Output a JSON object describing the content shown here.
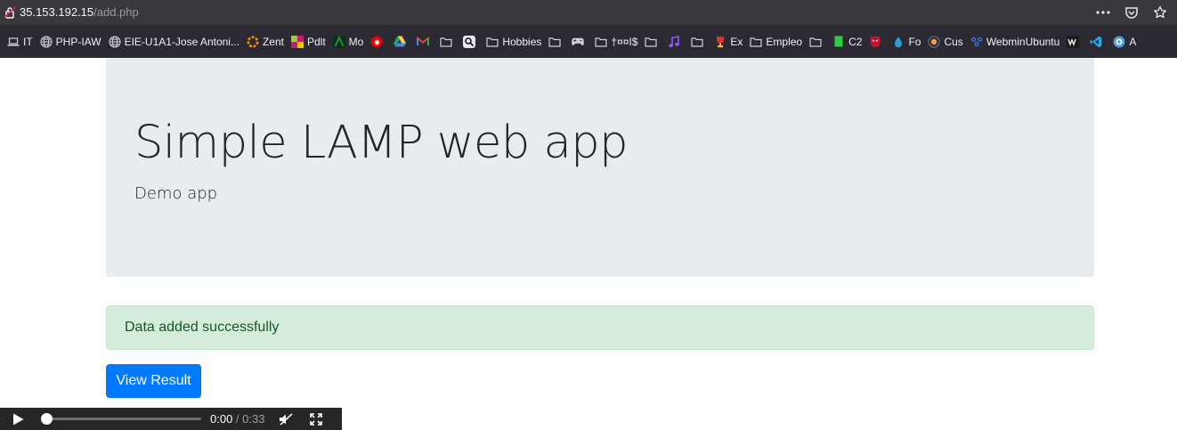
{
  "browser": {
    "url_host": "35.153.192.15",
    "url_path": "/add.php",
    "page_actions_icon": "ellipsis-icon",
    "pocket_icon": "pocket-icon",
    "bookmark_star_icon": "star-icon"
  },
  "bookmarks": [
    {
      "label": "IT",
      "icon": "laptop-icon",
      "color": "#cfcfd3"
    },
    {
      "label": "PHP-IAW",
      "icon": "globe-icon",
      "color": "#cfcfd3"
    },
    {
      "label": "EIE-U1A1-Jose Antoni...",
      "icon": "globe-icon",
      "color": "#cfcfd3"
    },
    {
      "label": "Zent",
      "icon": "zent-icon",
      "color": "#f29111"
    },
    {
      "label": "Pdlt",
      "icon": "pdlt-icon",
      "color": "#c71a75"
    },
    {
      "label": "Mo",
      "icon": "moodle-icon",
      "color": "#1e8f3c"
    },
    {
      "label": "",
      "icon": "vodafone-icon",
      "color": "#e60000"
    },
    {
      "label": "",
      "icon": "google-drive-icon",
      "color": "#1fa463"
    },
    {
      "label": "",
      "icon": "gmail-icon",
      "color": "#ea4335"
    },
    {
      "label": "",
      "icon": "folder-icon",
      "color": "#cfcfd3"
    },
    {
      "label": "",
      "icon": "magnifier-icon",
      "color": "#ffffff"
    },
    {
      "label": "Hobbies",
      "icon": "folder-icon",
      "color": "#cfcfd3"
    },
    {
      "label": "",
      "icon": "folder-icon",
      "color": "#cfcfd3"
    },
    {
      "label": "",
      "icon": "gamepad-icon",
      "color": "#cfcfd3"
    },
    {
      "label": "†¤¤I$",
      "icon": "folder-icon",
      "color": "#cfcfd3"
    },
    {
      "label": "",
      "icon": "folder-icon",
      "color": "#cfcfd3"
    },
    {
      "label": "",
      "icon": "music-note-icon",
      "color": "#8b5cf6"
    },
    {
      "label": "",
      "icon": "folder-icon",
      "color": "#cfcfd3"
    },
    {
      "label": "Ex",
      "icon": "trophy-icon",
      "color": "#e03131"
    },
    {
      "label": "Empleo",
      "icon": "folder-icon",
      "color": "#cfcfd3"
    },
    {
      "label": "",
      "icon": "folder-icon",
      "color": "#cfcfd3"
    },
    {
      "label": "C2",
      "icon": "green-square-icon",
      "color": "#2ecc40"
    },
    {
      "label": "",
      "icon": "shield-mask-icon",
      "color": "#c0152f"
    },
    {
      "label": "Fo",
      "icon": "water-drop-icon",
      "color": "#2d9cdb"
    },
    {
      "label": "Cus",
      "icon": "cus-icon",
      "color": "#5b6b8c"
    },
    {
      "label": "WebminUbuntu",
      "icon": "webmin-icon",
      "color": "#3a6fd8"
    },
    {
      "label": "",
      "icon": "w-icon",
      "color": "#cfcfd3"
    },
    {
      "label": "",
      "icon": "vscode-icon",
      "color": "#23a9f2"
    },
    {
      "label": "A",
      "icon": "circle-o-icon",
      "color": "#4d9de0"
    }
  ],
  "jumbotron": {
    "title": "Simple LAMP web app",
    "subtitle": "Demo app"
  },
  "alert": {
    "message": "Data added successfully"
  },
  "view_result_button": {
    "label": "View Result"
  },
  "player": {
    "current_time": "0:00",
    "separator": " / ",
    "duration": "0:33",
    "progress": 0.0
  },
  "colors": {
    "jumbotron_bg": "#e9ecef",
    "alert_bg": "#d4edda",
    "alert_text": "#155724",
    "primary": "#007bff"
  }
}
